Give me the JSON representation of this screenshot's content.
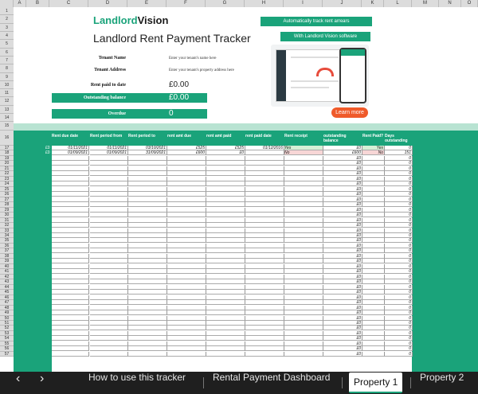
{
  "columns": [
    "A",
    "B",
    "C",
    "D",
    "E",
    "F",
    "G",
    "H",
    "I",
    "J",
    "K",
    "L",
    "M",
    "N",
    "O"
  ],
  "brand": {
    "logo_part1": "Landlord",
    "logo_part2": "Vision",
    "tracker_title": "Landlord Rent Payment Tracker"
  },
  "promo": {
    "badge1": "Automatically track rent arrears",
    "badge2": "With Landlord Vision software",
    "cta": "Learn more"
  },
  "fields": {
    "tenant_name_label": "Tenant Name",
    "tenant_name_value": "Enter your tenant's name here",
    "tenant_address_label": "Tenant Address",
    "tenant_address_value": "Enter your tenant's property address here",
    "rent_paid_label": "Rent paid to date",
    "rent_paid_value": "£0.00",
    "outstanding_label": "Outstanding balance",
    "outstanding_value": "£0.00",
    "overdue_label": "Overdue",
    "overdue_value": "0"
  },
  "table": {
    "headers": [
      "Rent due date",
      "Rent period from",
      "Rent period to",
      "rent amt due",
      "rent amt paid",
      "rent paid date",
      "Rent receipt",
      "outstanding balance",
      "Rent Paid?",
      "Days outstanding"
    ],
    "rows": [
      {
        "flag": "£0",
        "due": "01/11/2021",
        "from": "01/11/2021",
        "to": "03/10/2021",
        "amt_due": "£525",
        "amt_paid": "£525",
        "paid_date": "01/12/2016",
        "receipt": "Yes",
        "balance": "£0",
        "paid": "Yes",
        "days": "0"
      },
      {
        "flag": "£0",
        "due": "01/09/2021",
        "from": "01/09/2021",
        "to": "31/09/2021",
        "amt_due": "£600",
        "amt_paid": "£0",
        "paid_date": "",
        "receipt": "No",
        "balance": "£600",
        "paid": "No",
        "days": "151"
      }
    ],
    "empty_balance": "£0",
    "empty_days": "0"
  },
  "tabs": {
    "prev": "‹",
    "next": "›",
    "items": [
      "How to use this tracker",
      "Rental Payment Dashboard",
      "Property 1",
      "Property 2"
    ],
    "active": "Property 1"
  },
  "colors": {
    "brand_green": "#1aa37a",
    "cta_orange": "#ef5a2a",
    "yes_bg": "#d6f0d6",
    "no_bg": "#f7d6d6"
  }
}
